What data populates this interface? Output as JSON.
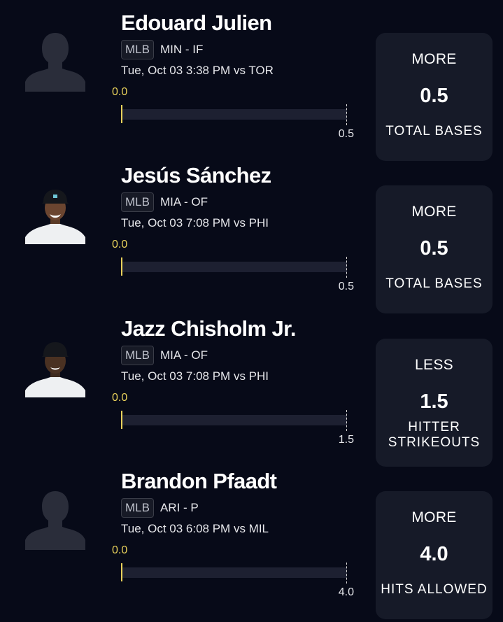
{
  "picks": [
    {
      "player": "Edouard Julien",
      "avatar_icon": "player-silhouette-icon",
      "league": "MLB",
      "team_pos": "MIN - IF",
      "game_time": "Tue, Oct 03 3:38 PM  vs TOR",
      "current": "0.0",
      "line_label": "0.5",
      "direction": "MORE",
      "line": "0.5",
      "stat_line1": "TOTAL BASES",
      "stat_line2": ""
    },
    {
      "player": "Jesús Sánchez",
      "avatar_icon": "player-headshot-icon",
      "league": "MLB",
      "team_pos": "MIA - OF",
      "game_time": "Tue, Oct 03 7:08 PM  vs PHI",
      "current": "0.0",
      "line_label": "0.5",
      "direction": "MORE",
      "line": "0.5",
      "stat_line1": "TOTAL BASES",
      "stat_line2": ""
    },
    {
      "player": "Jazz Chisholm Jr.",
      "avatar_icon": "player-headshot-icon",
      "league": "MLB",
      "team_pos": "MIA - OF",
      "game_time": "Tue, Oct 03 7:08 PM  vs PHI",
      "current": "0.0",
      "line_label": "1.5",
      "direction": "LESS",
      "line": "1.5",
      "stat_line1": "HITTER",
      "stat_line2": "STRIKEOUTS"
    },
    {
      "player": "Brandon Pfaadt",
      "avatar_icon": "player-silhouette-icon",
      "league": "MLB",
      "team_pos": "ARI - P",
      "game_time": "Tue, Oct 03 6:08 PM  vs MIL",
      "current": "0.0",
      "line_label": "4.0",
      "direction": "MORE",
      "line": "4.0",
      "stat_line1": "HITS ALLOWED",
      "stat_line2": ""
    }
  ],
  "colors": {
    "background": "#070a18",
    "card": "#161a28",
    "progress_accent": "#e9d25b",
    "track": "#1d2031"
  }
}
